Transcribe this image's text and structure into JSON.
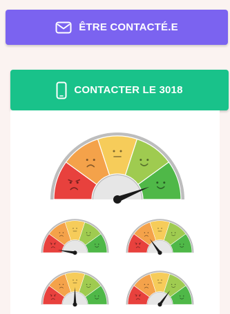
{
  "buttons": {
    "contact_label": "ÊTRE CONTACTÉ.E",
    "contact_icon": "envelope-icon",
    "call_label": "CONTACTER LE 3018",
    "call_icon": "smartphone-icon"
  },
  "colors": {
    "contact_button": "#7b63f0",
    "call_button": "#19c28a",
    "gauge_red": "#e8413d",
    "gauge_orange": "#f4a24a",
    "gauge_yellow": "#f6cc5a",
    "gauge_light_green": "#9fcb50",
    "gauge_green": "#4fb848",
    "needle": "#1a1a1a"
  },
  "gauges": [
    {
      "name": "main-gauge",
      "level": 0.88
    },
    {
      "name": "small-gauge-1",
      "level": 0.05
    },
    {
      "name": "small-gauge-2",
      "level": 0.3
    },
    {
      "name": "small-gauge-3",
      "level": 0.5
    },
    {
      "name": "small-gauge-4",
      "level": 0.7
    }
  ]
}
